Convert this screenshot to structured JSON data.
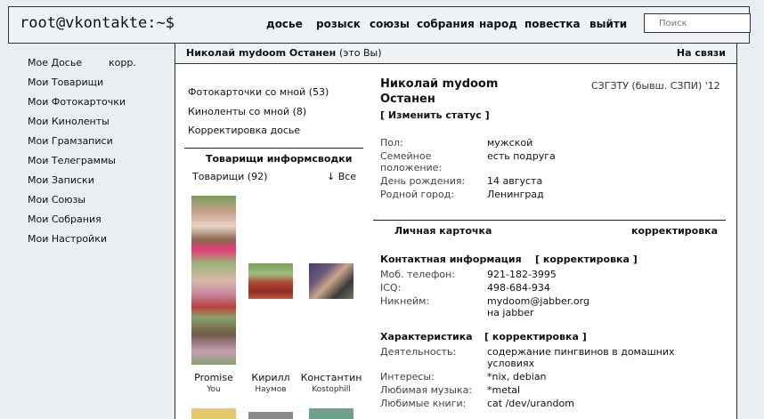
{
  "header": {
    "logo": "root@vkontakte:~$",
    "nav": [
      "досье",
      "розыск",
      "союзы",
      "собрания",
      "народ",
      "повестка",
      "выйти"
    ],
    "search_placeholder": "Поиск"
  },
  "profile_bar": {
    "name": "Николай mydoom Останен",
    "you": "(это Вы)",
    "status": "На связи"
  },
  "sidebar": {
    "items": [
      "Мое Досье",
      "Мои Товарищи",
      "Мои Фотокарточки",
      "Мои Киноленты",
      "Мои Грамзаписи",
      "Мои Телеграммы",
      "Мои Записки",
      "Мои Союзы",
      "Мои Собрания",
      "Мои Настройки"
    ],
    "edit": "корр."
  },
  "left_links": [
    "Фотокарточки со мной (53)",
    "Киноленты со мной (8)",
    "Корректировка досье"
  ],
  "friends": {
    "title": "Товарищи информсводки",
    "count_label": "Товарищи (92)",
    "all_label": "↓ Все",
    "people": [
      {
        "name": "Promise",
        "sub": "You"
      },
      {
        "name": "Кирилл",
        "sub": "Наумов"
      },
      {
        "name": "Константин",
        "sub": "Kostophill"
      }
    ]
  },
  "profile": {
    "name_line1": "Николай mydoom",
    "name_line2": "Останен",
    "university": "СЗГЗТУ (бывш. СЗПИ) '12",
    "change_status": "[ Изменить статус ]",
    "basic": [
      {
        "label": "Пол:",
        "value": "мужской"
      },
      {
        "label": "Семейное\nположение:",
        "value": "есть подруга"
      },
      {
        "label": "День рождения:",
        "value": "14 августа"
      },
      {
        "label": "Родной город:",
        "value": "Ленинград"
      }
    ],
    "card_title": "Личная карточка",
    "card_edit": "корректировка",
    "contact_title": "Контактная информация",
    "edit_bracket": "[ корректировка ]",
    "contacts": [
      {
        "label": "Моб. телефон:",
        "value": "921-182-3995"
      },
      {
        "label": "ICQ:",
        "value": "498-684-934"
      },
      {
        "label": "Никнейм:",
        "value": "mydoom@jabber.org\nна jabber"
      }
    ],
    "char_title": "Характеристика",
    "chars": [
      {
        "label": "Деятельность:",
        "value": "содержание пингвинов в домашних\nусловиях"
      },
      {
        "label": "Интересы:",
        "value": "*nix, debian"
      },
      {
        "label": "Любимая музыка:",
        "value": "*metal"
      },
      {
        "label": "Любимые книги:",
        "value": "cat /dev/urandom"
      }
    ]
  },
  "colors": {
    "background": "#e8eef2",
    "panel": "#ffffff",
    "border": "#333333"
  }
}
